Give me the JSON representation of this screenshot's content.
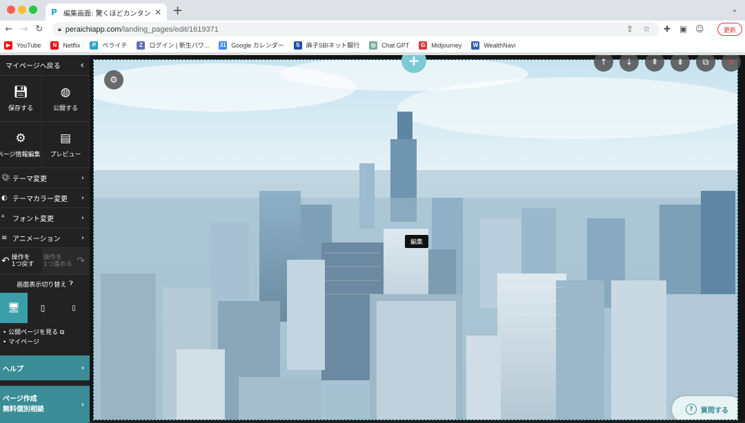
{
  "browser": {
    "tab_title": "編集画面: 驚くほどカンタン！無料",
    "tab_favicon": "P",
    "url_domain": "peraichiapp.com",
    "url_path": "/landing_pages/edit/1619371",
    "update_label": "更新"
  },
  "bookmarks": [
    {
      "label": "YouTube",
      "icon": "youtube-icon",
      "color": "#ff0000",
      "glyph": "▶"
    },
    {
      "label": "Netflix",
      "icon": "netflix-icon",
      "color": "#e50914",
      "glyph": "N"
    },
    {
      "label": "ペライチ",
      "icon": "peraichi-icon",
      "color": "#2aa5c8",
      "glyph": "P"
    },
    {
      "label": "ログイン | 新生パワ...",
      "icon": "login-icon",
      "color": "#5b6fb5",
      "glyph": "Z"
    },
    {
      "label": "Google カレンダー",
      "icon": "calendar-icon",
      "color": "#4285f4",
      "glyph": "31"
    },
    {
      "label": "麻子SBIネット銀行",
      "icon": "sbi-icon",
      "color": "#1f4ea3",
      "glyph": "S"
    },
    {
      "label": "Chat GPT",
      "icon": "chatgpt-icon",
      "color": "#74aa9c",
      "glyph": "◎"
    },
    {
      "label": "Midjourney",
      "icon": "midjourney-icon",
      "color": "#d63b3b",
      "glyph": "G"
    },
    {
      "label": "WealthNavi",
      "icon": "wealthnavi-icon",
      "color": "#2f5fb3",
      "glyph": "W"
    }
  ],
  "sidebar": {
    "back_label": "マイページへ戻る",
    "save_label": "保存する",
    "publish_label": "公開する",
    "page_info_label": "ページ情報編集",
    "preview_label": "プレビュー",
    "menu": [
      {
        "label": "テーマ変更",
        "icon": "palette-icon"
      },
      {
        "label": "テーマカラー変更",
        "icon": "color-palette-icon"
      },
      {
        "label": "フォント変更",
        "icon": "font-icon"
      },
      {
        "label": "アニメーション",
        "icon": "animation-icon"
      }
    ],
    "undo_line1": "操作を",
    "undo_line2": "1つ戻す",
    "redo_line1": "操作を",
    "redo_line2": "1つ進める",
    "view_switch_label": "画面表示切り替え",
    "view_public_label": "公開ページを見る",
    "mypage_label": "マイページ",
    "help_label": "ヘルプ",
    "consult_line1": "ページ作成",
    "consult_line2": "無料個別相談"
  },
  "editor": {
    "edit_tooltip": "編集",
    "ask_label": "質問する"
  },
  "colors": {
    "accent": "#3a8d96",
    "device_active": "#3a9ea8",
    "update_red": "#dd3333"
  }
}
